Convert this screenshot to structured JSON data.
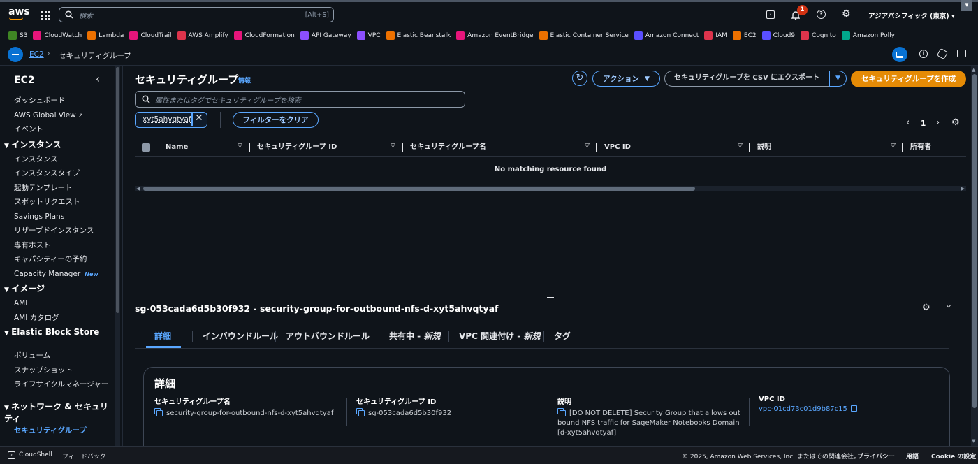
{
  "topnav": {
    "logo": "aws",
    "search_placeholder": "検索",
    "search_shortcut": "[Alt+S]",
    "notification_count": "1",
    "region": "アジアパシフィック (東京)"
  },
  "favorites": [
    {
      "label": "S3",
      "color": "#3f8624"
    },
    {
      "label": "CloudWatch",
      "color": "#e7157b"
    },
    {
      "label": "Lambda",
      "color": "#ed7100"
    },
    {
      "label": "CloudTrail",
      "color": "#e7157b"
    },
    {
      "label": "AWS Amplify",
      "color": "#dd344c"
    },
    {
      "label": "CloudFormation",
      "color": "#e7157b"
    },
    {
      "label": "API Gateway",
      "color": "#8c4fff"
    },
    {
      "label": "VPC",
      "color": "#8c4fff"
    },
    {
      "label": "Elastic Beanstalk",
      "color": "#ed7100"
    },
    {
      "label": "Amazon EventBridge",
      "color": "#e7157b"
    },
    {
      "label": "Elastic Container Service",
      "color": "#ed7100"
    },
    {
      "label": "Amazon Connect",
      "color": "#5a4fff"
    },
    {
      "label": "IAM",
      "color": "#dd344c"
    },
    {
      "label": "EC2",
      "color": "#ed7100"
    },
    {
      "label": "Cloud9",
      "color": "#5a4fff"
    },
    {
      "label": "Cognito",
      "color": "#dd344c"
    },
    {
      "label": "Amazon Polly",
      "color": "#01a88d"
    }
  ],
  "breadcrumb": {
    "root": "EC2",
    "current": "セキュリティグループ"
  },
  "sidebar": {
    "title": "EC2",
    "top_items": [
      "ダッシュボード",
      "AWS Global View",
      "イベント"
    ],
    "sections": [
      {
        "title": "インスタンス",
        "items": [
          "インスタンス",
          "インスタンスタイプ",
          "起動テンプレート",
          "スポットリクエスト",
          "Savings Plans",
          "リザーブドインスタンス",
          "専有ホスト",
          "キャパシティーの予約",
          "Capacity Manager"
        ]
      },
      {
        "title": "イメージ",
        "items": [
          "AMI",
          "AMI カタログ"
        ]
      },
      {
        "title": "Elastic Block Store",
        "items": [
          "ボリューム",
          "スナップショット",
          "ライフサイクルマネージャー"
        ]
      },
      {
        "title": "ネットワーク & セキュリティ",
        "items": [
          "セキュリティグループ"
        ]
      }
    ],
    "new_badge": "New"
  },
  "main": {
    "title": "セキュリティグループ",
    "info_link": "情報",
    "actions_button": "アクション",
    "export_button": "セキュリティグループを CSV にエクスポート",
    "create_button": "セキュリティグループを作成",
    "search_placeholder": "属性またはタグでセキュリティグループを検索",
    "filter_token": "xyt5ahvqtyaf",
    "clear_filters": "フィルターをクリア",
    "page_number": "1",
    "columns": [
      "Name",
      "セキュリティグループ ID",
      "セキュリティグループ名",
      "VPC ID",
      "説明",
      "所有者"
    ],
    "empty_message": "No matching resource found"
  },
  "detail": {
    "heading": "sg-053cada6d5b30f932 - security-group-for-outbound-nfs-d-xyt5ahvqtyaf",
    "tabs": [
      {
        "label": "詳細"
      },
      {
        "label": "インバウンドルール"
      },
      {
        "label": "アウトバウンドルール"
      },
      {
        "label": "共有中 - ",
        "suffix": "新規"
      },
      {
        "label": "VPC 関連付け - ",
        "suffix": "新規"
      },
      {
        "label": "タグ"
      }
    ],
    "card_title": "詳細",
    "fields": {
      "name_label": "セキュリティグループ名",
      "name_value": "security-group-for-outbound-nfs-d-xyt5ahvqtyaf",
      "id_label": "セキュリティグループ ID",
      "id_value": "sg-053cada6d5b30f932",
      "desc_label": "説明",
      "desc_value": "[DO NOT DELETE] Security Group that allows outbound NFS traffic for SageMaker Notebooks Domain [d-xyt5ahvqtyaf]",
      "vpc_label": "VPC ID",
      "vpc_value": "vpc-01cd73c01d9b87c15"
    }
  },
  "footer": {
    "cloudshell": "CloudShell",
    "feedback": "フィードバック",
    "copyright": "© 2025, Amazon Web Services, Inc. またはその関連会社。",
    "privacy": "プライバシー",
    "terms": "用語",
    "cookie": "Cookie の設定"
  }
}
